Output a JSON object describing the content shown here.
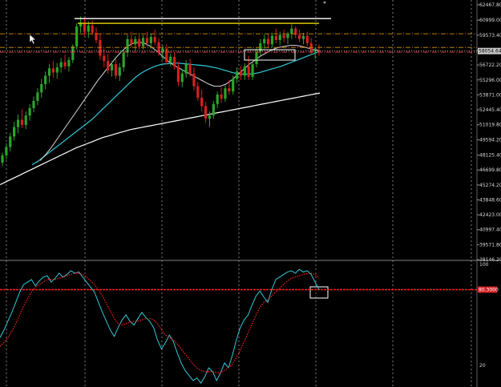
{
  "chart_data": [
    {
      "type": "candlestick",
      "panel": "price",
      "y_axis": {
        "ticks": [
          62467.8,
          60999.0,
          59573.4,
          58145.6,
          56722.2,
          55296.0,
          53871.0,
          52445.4,
          51019.8,
          49594.2,
          48125.4,
          46699.8,
          45274.2,
          43848.6,
          42423.0,
          40997.4,
          39571.8,
          38146.2
        ],
        "tick_labels": [
          "62467.80",
          "60999.00",
          "59573.40",
          "58145.60",
          "56722.20",
          "55296.00",
          "53871.00",
          "52445.40",
          "51019.80",
          "49594.20",
          "48125.40",
          "46699.80",
          "45274.20",
          "43848.60",
          "42423.00",
          "40997.40",
          "39571.80",
          "38146.20"
        ],
        "range": [
          38146.2,
          62467.8
        ]
      },
      "current_price_label": "58054.64",
      "horizontal_lines": [
        {
          "price": 61150,
          "color": "#ffffff",
          "style": "solid"
        },
        {
          "price": 60700,
          "color": "#d4c400",
          "style": "solid"
        },
        {
          "price": 59700,
          "color": "#d89000",
          "style": "dash-dot"
        },
        {
          "price": 58400,
          "color": "#d89000",
          "style": "dash-dot"
        },
        {
          "price": 58054.64,
          "color": "#c0c0c0",
          "style": "dotted"
        },
        {
          "price": 57950,
          "color": "#ff4040",
          "style": "dash-dot"
        }
      ],
      "candles": {
        "up_color": "#2aa52a",
        "down_color": "#d42020",
        "ohlc": [
          [
            47400,
            48350,
            47050,
            48100
          ],
          [
            48100,
            49250,
            47700,
            48900
          ],
          [
            48900,
            50250,
            48500,
            49900
          ],
          [
            49900,
            51300,
            49500,
            50800
          ],
          [
            50800,
            52000,
            50200,
            51500
          ],
          [
            51500,
            52500,
            50700,
            51000
          ],
          [
            51000,
            52300,
            50600,
            51900
          ],
          [
            51900,
            53000,
            51400,
            52600
          ],
          [
            52600,
            53700,
            52200,
            53300
          ],
          [
            53300,
            54500,
            52900,
            54100
          ],
          [
            54100,
            55400,
            53600,
            54900
          ],
          [
            54900,
            56100,
            54400,
            55700
          ],
          [
            55700,
            56800,
            55000,
            56400
          ],
          [
            56400,
            57100,
            55500,
            56000
          ],
          [
            56000,
            56900,
            55400,
            56500
          ],
          [
            56500,
            57400,
            56000,
            57000
          ],
          [
            57000,
            57700,
            56300,
            56600
          ],
          [
            56600,
            57500,
            56100,
            57200
          ],
          [
            57200,
            58700,
            56900,
            58500
          ],
          [
            58500,
            60700,
            58200,
            60400
          ],
          [
            60400,
            61350,
            59800,
            60800
          ],
          [
            60800,
            61300,
            59500,
            59900
          ],
          [
            59900,
            60900,
            59300,
            60500
          ],
          [
            60500,
            61000,
            59600,
            59800
          ],
          [
            59800,
            60300,
            58800,
            59100
          ],
          [
            59100,
            59700,
            57200,
            57600
          ],
          [
            57600,
            58300,
            56500,
            57100
          ],
          [
            57100,
            57800,
            55900,
            56200
          ],
          [
            56200,
            57100,
            55600,
            56800
          ],
          [
            56800,
            57300,
            55400,
            55700
          ],
          [
            55700,
            56900,
            55200,
            56500
          ],
          [
            56500,
            58200,
            56100,
            57900
          ],
          [
            57900,
            59600,
            57500,
            59200
          ],
          [
            59200,
            59900,
            58400,
            58700
          ],
          [
            58700,
            59500,
            58100,
            59200
          ],
          [
            59200,
            59800,
            58200,
            58500
          ],
          [
            58500,
            59600,
            58200,
            59300
          ],
          [
            59300,
            59900,
            58500,
            58800
          ],
          [
            58800,
            59700,
            58300,
            59400
          ],
          [
            59400,
            60100,
            58600,
            58900
          ],
          [
            58900,
            59300,
            57600,
            57900
          ],
          [
            57900,
            58600,
            57200,
            58300
          ],
          [
            58300,
            58700,
            56800,
            57000
          ],
          [
            57000,
            57800,
            56600,
            57500
          ],
          [
            57500,
            58000,
            56300,
            56600
          ],
          [
            56600,
            57000,
            54700,
            55100
          ],
          [
            55100,
            56300,
            54600,
            55900
          ],
          [
            55900,
            57200,
            55500,
            56800
          ],
          [
            56800,
            57300,
            55600,
            55900
          ],
          [
            55900,
            56500,
            54300,
            54700
          ],
          [
            54700,
            55100,
            53300,
            53600
          ],
          [
            53600,
            54400,
            52300,
            52800
          ],
          [
            52800,
            53200,
            51200,
            51600
          ],
          [
            51600,
            52300,
            50800,
            51900
          ],
          [
            51900,
            53300,
            51600,
            53000
          ],
          [
            53000,
            54200,
            52600,
            53900
          ],
          [
            53900,
            54600,
            53100,
            53500
          ],
          [
            53500,
            54800,
            53200,
            54500
          ],
          [
            54500,
            55300,
            53900,
            54200
          ],
          [
            54200,
            55700,
            53900,
            55400
          ],
          [
            55400,
            56500,
            55000,
            56100
          ],
          [
            56100,
            56600,
            55300,
            55700
          ],
          [
            55700,
            56900,
            55300,
            56600
          ],
          [
            56600,
            57600,
            55300,
            55600
          ],
          [
            55600,
            57000,
            55300,
            56800
          ],
          [
            56800,
            58300,
            56500,
            58000
          ],
          [
            58000,
            59200,
            57600,
            58800
          ],
          [
            58800,
            59600,
            58300,
            59200
          ],
          [
            59200,
            59700,
            58400,
            58700
          ],
          [
            58700,
            59800,
            58400,
            59500
          ],
          [
            59500,
            60200,
            58800,
            59100
          ],
          [
            59100,
            59900,
            58600,
            59600
          ],
          [
            59600,
            60100,
            58900,
            59300
          ],
          [
            59300,
            59900,
            58700,
            59700
          ],
          [
            59700,
            60600,
            59200,
            60200
          ],
          [
            60200,
            60400,
            59300,
            59600
          ],
          [
            59600,
            60100,
            58900,
            59200
          ],
          [
            59200,
            59800,
            58700,
            59500
          ],
          [
            59500,
            59900,
            58500,
            58800
          ],
          [
            58800,
            59300,
            57700,
            58000
          ],
          [
            58000,
            58400,
            57300,
            58100
          ],
          [
            58100,
            58700,
            57600,
            58054.64
          ]
        ]
      },
      "overlays": [
        {
          "name": "",
          "color": "#ffffff",
          "width": 1.2,
          "values": [
            45300,
            45550,
            45800,
            46050,
            46300,
            46550,
            46800,
            47050,
            47300,
            47550,
            47800,
            48050,
            48300,
            48550,
            48800,
            49000,
            49200,
            49400,
            49600,
            49800,
            49950,
            50100,
            50250,
            50400,
            50550,
            50650,
            50750,
            50850,
            50950,
            51050,
            51150,
            51250,
            51350,
            51450,
            51550,
            51650,
            51750,
            51850,
            51950,
            52050,
            52150,
            52250,
            52350,
            52450,
            52550,
            52650,
            52750,
            52850,
            52950,
            53050,
            53150,
            53250,
            53350,
            53450,
            53550,
            53650,
            53750,
            53850,
            53950,
            54050
          ]
        },
        {
          "name": "",
          "color": "#30c8d8",
          "width": 1.2,
          "values": [
            47200,
            47500,
            47900,
            48300,
            48700,
            49100,
            49500,
            49900,
            50300,
            50700,
            51100,
            51500,
            52000,
            52500,
            53000,
            53500,
            54000,
            54500,
            55000,
            55500,
            55900,
            56200,
            56450,
            56650,
            56800,
            56850,
            56900,
            56900,
            56850,
            56800,
            56750,
            56700,
            56650,
            56550,
            56450,
            56300,
            56150,
            56000,
            55900,
            55850,
            55850,
            55900,
            56000,
            56150,
            56300,
            56450,
            56600,
            56800,
            57000,
            57200,
            57400,
            57600,
            57800,
            58000
          ]
        },
        {
          "name": "",
          "color": "#d8d8d8",
          "width": 1.0,
          "values": [
            47600,
            48200,
            48900,
            49700,
            50500,
            51300,
            52100,
            52900,
            53700,
            54500,
            55300,
            56000,
            56700,
            57400,
            58000,
            58500,
            58800,
            58900,
            58800,
            58500,
            58100,
            57600,
            57100,
            56700,
            56400,
            56100,
            55800,
            55500,
            55200,
            54900,
            54700,
            54700,
            54900,
            55300,
            55800,
            56300,
            56800,
            57200,
            57600,
            57900,
            58200,
            58400,
            58500,
            58600,
            58600,
            58500,
            58350,
            58200,
            58100
          ]
        }
      ]
    },
    {
      "type": "line",
      "panel": "oscillator",
      "y_axis": {
        "ticks": [
          100,
          20
        ],
        "tick_labels": [
          "100",
          "20"
        ],
        "range": [
          0,
          105
        ]
      },
      "level_line": {
        "value": 80,
        "label": "80.3000",
        "color": "#ff2020"
      },
      "series": [
        {
          "name": "",
          "color": "#30c8d8",
          "style": "solid",
          "values": [
            42,
            48,
            55,
            62,
            70,
            78,
            84,
            86,
            88,
            83,
            87,
            90,
            91,
            86,
            89,
            93,
            90,
            92,
            95,
            93,
            94,
            90,
            86,
            82,
            78,
            70,
            62,
            55,
            48,
            43,
            50,
            56,
            60,
            55,
            52,
            57,
            62,
            58,
            55,
            50,
            40,
            33,
            38,
            44,
            39,
            30,
            22,
            16,
            12,
            8,
            10,
            6,
            11,
            18,
            15,
            8,
            14,
            22,
            18,
            28,
            40,
            50,
            56,
            60,
            68,
            75,
            79,
            74,
            70,
            80,
            88,
            90,
            92,
            94,
            95,
            93,
            96,
            94,
            95,
            92,
            86,
            80
          ]
        },
        {
          "name": "",
          "color": "#ff2020",
          "style": "dotted",
          "values": [
            35,
            38,
            42,
            47,
            53,
            60,
            67,
            73,
            78,
            82,
            84,
            86,
            88,
            88,
            88,
            89,
            90,
            91,
            92,
            93,
            93,
            92,
            90,
            87,
            84,
            80,
            75,
            69,
            63,
            57,
            53,
            52,
            53,
            54,
            55,
            55,
            56,
            57,
            57,
            56,
            53,
            48,
            44,
            42,
            40,
            37,
            33,
            29,
            25,
            21,
            18,
            16,
            15,
            15,
            15,
            14,
            14,
            16,
            18,
            21,
            26,
            32,
            39,
            46,
            53,
            60,
            66,
            70,
            72,
            75,
            78,
            81,
            84,
            87,
            89,
            90,
            91,
            92,
            93,
            93,
            92,
            89
          ]
        }
      ]
    }
  ]
}
